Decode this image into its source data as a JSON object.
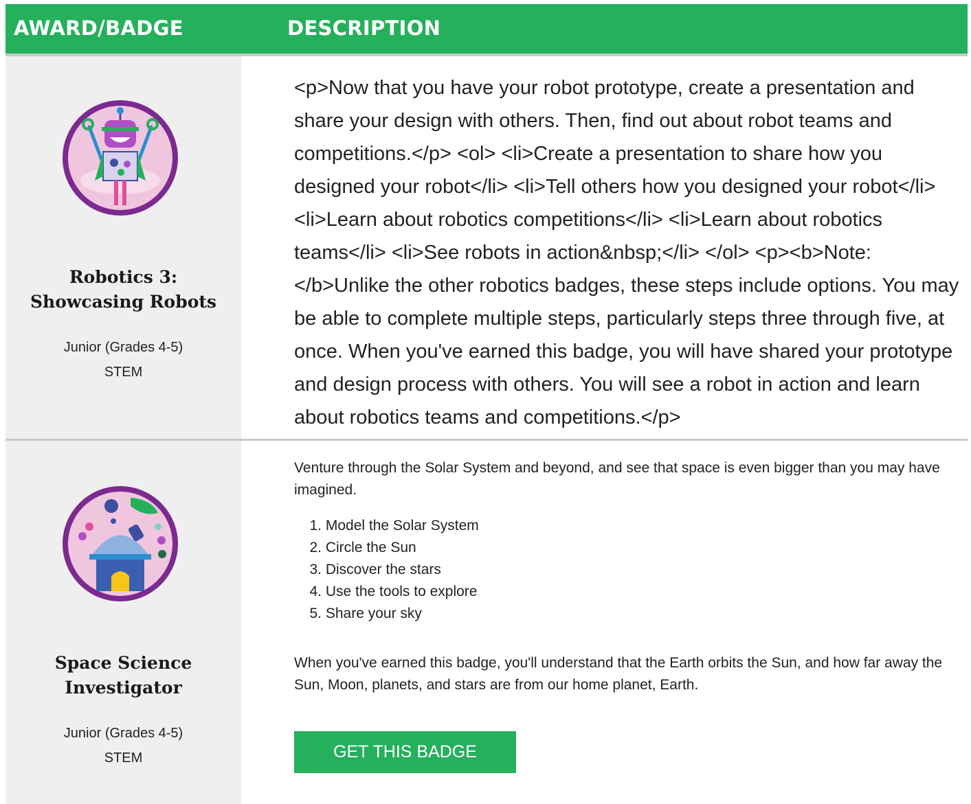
{
  "header": {
    "award_label": "AWARD/BADGE",
    "description_label": "DESCRIPTION"
  },
  "badges": [
    {
      "title_line1": "Robotics 3:",
      "title_line2": "Showcasing Robots",
      "level": "Junior (Grades 4-5)",
      "category": "STEM",
      "icon": "robot-badge-icon",
      "description": "<p>Now that you have your robot prototype, create a presentation and share your design with others. Then, find out about robot teams and competitions.</p> <ol> <li>Create a presentation to share how you designed your robot</li> <li>Tell others how you designed your robot</li> <li>Learn about robotics competitions</li> <li>Learn about robotics teams</li> <li>See robots in action&nbsp;</li> </ol> <p><b>Note: </b>Unlike the other robotics badges, these steps include options. You may be able to complete multiple steps, particularly steps three through five, at once. When you've earned this badge, you will have shared your prototype and design process with others. You will see a robot in action and learn about robotics teams and competitions.</p>"
    },
    {
      "title_line1": "Space Science",
      "title_line2": "Investigator",
      "level": "Junior (Grades 4-5)",
      "category": "STEM",
      "icon": "observatory-badge-icon",
      "intro": "Venture through the Solar System and beyond, and see that space is even bigger than you may have imagined.",
      "steps": [
        {
          "num": "1.",
          "text": "Model the Solar System"
        },
        {
          "num": "2.",
          "text": "Circle the Sun"
        },
        {
          "num": "3.",
          "text": "Discover the stars"
        },
        {
          "num": "4.",
          "text": "Use the tools to explore"
        },
        {
          "num": "5.",
          "text": "Share your sky"
        }
      ],
      "outro": "When you've earned this badge, you'll understand that the Earth orbits the Sun, and how far away the Sun, Moon, planets, and stars are from our home planet, Earth.",
      "button_label": "GET THIS BADGE"
    }
  ],
  "colors": {
    "brand_green": "#25b05c",
    "badge_ring": "#7b2a8f",
    "badge_fill": "#f0c6df"
  }
}
